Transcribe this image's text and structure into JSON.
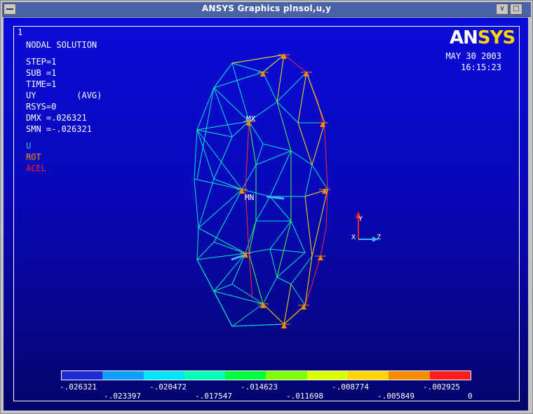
{
  "window": {
    "title": "ANSYS Graphics    plnsol,u,y",
    "buttons": {
      "minimize": "∨",
      "restore": "□"
    }
  },
  "viewport": {
    "number": "1"
  },
  "solution": {
    "heading": "NODAL SOLUTION",
    "step": "STEP=1",
    "sub": "SUB =1",
    "time": "TIME=1",
    "result": "UY        (AVG)",
    "rsys": "RSYS=0",
    "dmx": "DMX =.026321",
    "smn": "SMN =-.026321"
  },
  "legend": {
    "u": "U",
    "rot": "ROT",
    "acel": "ACEL"
  },
  "logo": {
    "part1": "AN",
    "part2": "SYS"
  },
  "date": "MAY 30 2003",
  "time": "16:15:23",
  "markers": {
    "mx": "MX",
    "mn": "MN"
  },
  "triad": {
    "y": "Y",
    "z": "Z",
    "x": "X"
  },
  "contour": {
    "colors": [
      "#1c2bd4",
      "#0e9eff",
      "#00e6ff",
      "#00ffb4",
      "#00ff3c",
      "#80ff00",
      "#d9ff00",
      "#ffd400",
      "#ff8c00",
      "#ff1e1e"
    ],
    "labels_top": [
      "-.026321",
      "-.020472",
      "-.014623",
      "-.008774",
      "-.002925"
    ],
    "labels_bottom": [
      "-.023397",
      "-.017547",
      "-.011698",
      "-.005849",
      "0"
    ]
  },
  "colors": {
    "u": "#3ab7ff",
    "rot": "#ff8800",
    "acel": "#ff2020",
    "logo_accent": "#ffd400"
  }
}
